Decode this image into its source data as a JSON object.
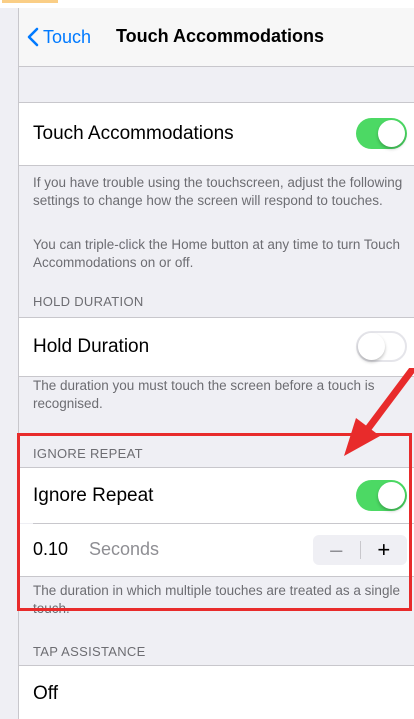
{
  "navbar": {
    "back_label": "Touch",
    "title": "Touch Accommodations"
  },
  "touch_accommodations": {
    "label": "Touch Accommodations",
    "enabled": true,
    "footnote_1": "If you have trouble using the touchscreen, adjust the following settings to change how the screen will respond to touches.",
    "footnote_2": "You can triple-click the Home button at any time to turn Touch Accommodations on or off."
  },
  "hold_duration": {
    "header": "HOLD DURATION",
    "label": "Hold Duration",
    "enabled": false,
    "footnote": "The duration you must touch the screen before a touch is recognised."
  },
  "ignore_repeat": {
    "header": "IGNORE REPEAT",
    "label": "Ignore Repeat",
    "enabled": true,
    "value": "0.10",
    "unit": "Seconds",
    "minus": "–",
    "plus": "+",
    "footnote": "The duration in which multiple touches are treated as a single touch."
  },
  "tap_assistance": {
    "header": "TAP ASSISTANCE",
    "selected": "Off"
  },
  "colors": {
    "accent": "#007aff",
    "switch_on": "#4cd964",
    "annotation": "#e82b2b"
  }
}
